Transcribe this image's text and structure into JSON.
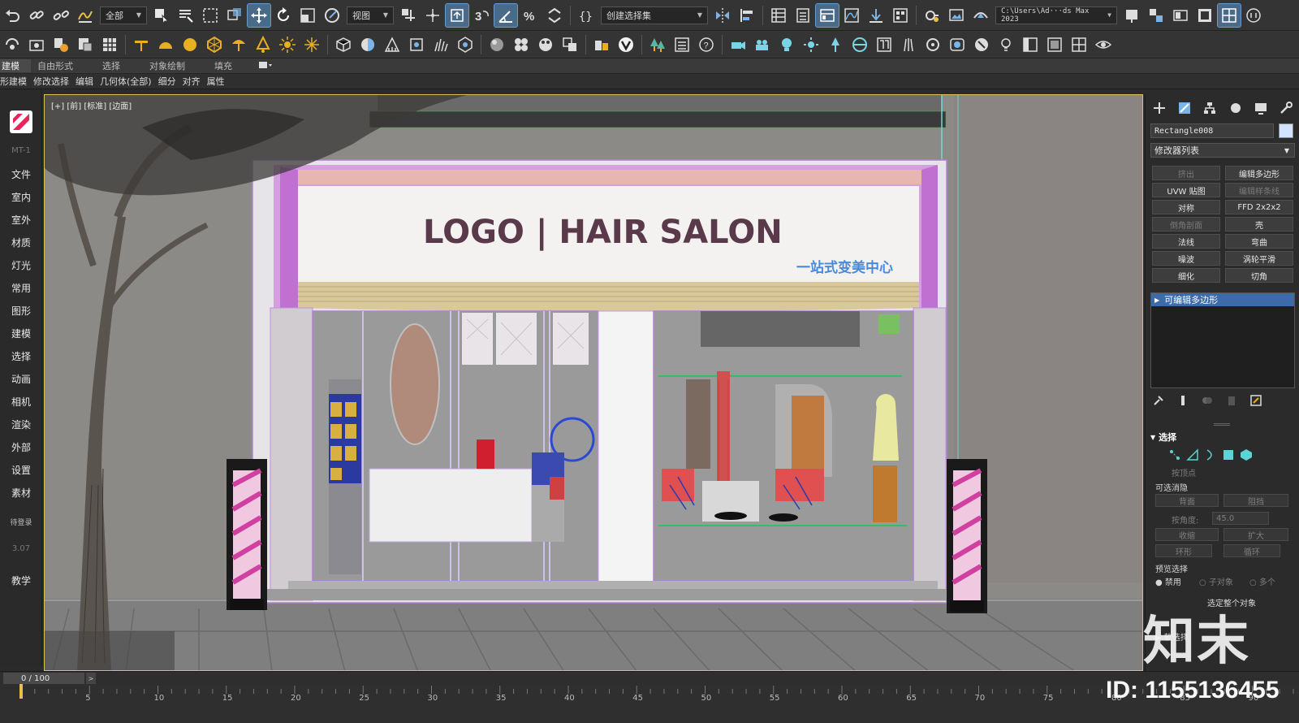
{
  "toolbar": {
    "selection_filter": "全部",
    "ref_coord_system": "视图",
    "named_selection": "创建选择集",
    "project_path": "C:\\Users\\Ad···ds Max 2023"
  },
  "ribbon": {
    "tabs": [
      "建模",
      "自由形式",
      "选择",
      "对象绘制",
      "填充"
    ],
    "subtabs": [
      "形建模",
      "修改选择",
      "编辑",
      "几何体(全部)",
      "细分",
      "对齐",
      "属性"
    ]
  },
  "left_panel": {
    "version_label": "MT-1",
    "items": [
      "文件",
      "室内",
      "室外",
      "材质",
      "灯光",
      "常用",
      "图形",
      "建模",
      "选择",
      "动画",
      "相机",
      "渲染",
      "外部",
      "设置",
      "素材"
    ],
    "login": "待登录",
    "build": "3.07",
    "tutorial": "教学"
  },
  "viewport": {
    "label": "[+] [前] [标准] [边面]",
    "sign_main": "LOGO  |  HAIR SALON",
    "sign_sub": "一站式变美中心"
  },
  "command_panel": {
    "object_name": "Rectangle008",
    "modifier_list": "修改器列表",
    "modifier_buttons": [
      {
        "label": "挤出",
        "enabled": false
      },
      {
        "label": "编辑多边形",
        "enabled": true
      },
      {
        "label": "UVW 贴图",
        "enabled": true
      },
      {
        "label": "编辑样条线",
        "enabled": false
      },
      {
        "label": "对称",
        "enabled": true
      },
      {
        "label": "FFD 2x2x2",
        "enabled": true
      },
      {
        "label": "倒角剖面",
        "enabled": false
      },
      {
        "label": "壳",
        "enabled": true
      },
      {
        "label": "法线",
        "enabled": true
      },
      {
        "label": "弯曲",
        "enabled": true
      },
      {
        "label": "噪波",
        "enabled": true
      },
      {
        "label": "涡轮平滑",
        "enabled": true
      },
      {
        "label": "细化",
        "enabled": true
      },
      {
        "label": "切角",
        "enabled": true
      }
    ],
    "stack_item": "可编辑多边形",
    "selection_rollout": {
      "title": "选择",
      "by_vertex": "按顶点",
      "ignore_backfacing": "可选消隐",
      "backface": "背面",
      "occluded": "阻挡",
      "by_angle": "按角度:",
      "angle_value": "45.0",
      "shrink": "收缩",
      "grow": "扩大",
      "ring": "环形",
      "loop": "循环",
      "preview_selection": "预览选择",
      "off": "禁用",
      "subobject": "子对象",
      "multi": "多个",
      "select_whole": "选定整个对象",
      "soft_select": "软选择"
    }
  },
  "timeline": {
    "frame_display": "0 / 100",
    "ticks": [
      "5",
      "10",
      "15",
      "20",
      "25",
      "30",
      "35",
      "40",
      "45",
      "50",
      "55",
      "60",
      "65",
      "70",
      "75",
      "80",
      "85",
      "90"
    ]
  },
  "watermark": {
    "brand": "知末",
    "id_text": "ID: 1155136455"
  },
  "colors": {
    "accent_blue": "#3d6aa8",
    "sign_text": "#5a3a4a",
    "sign_sub_text": "#4a8ad8",
    "viewport_bg": "#8b8b8b"
  }
}
